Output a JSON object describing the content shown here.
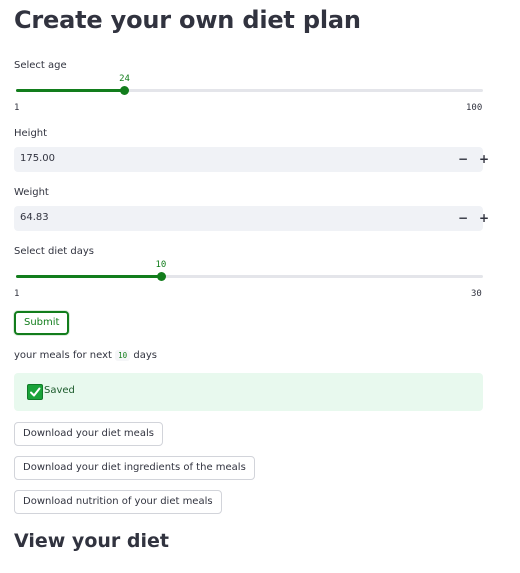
{
  "page": {
    "title": "Create your own diet plan",
    "section_heading": "View your diet"
  },
  "age_slider": {
    "label": "Select age",
    "value": 24,
    "min": 1,
    "max": 100,
    "min_label": "1",
    "max_label": "100",
    "value_label": "24"
  },
  "height_input": {
    "label": "Height",
    "value": "175.00",
    "minus": "−",
    "plus": "+"
  },
  "weight_input": {
    "label": "Weight",
    "value": "64.83",
    "minus": "−",
    "plus": "+"
  },
  "days_slider": {
    "label": "Select diet days",
    "value": 10,
    "min": 1,
    "max": 30,
    "min_label": "1",
    "max_label": "30",
    "value_label": "10"
  },
  "submit_button": {
    "label": "Submit"
  },
  "meals_text": {
    "prefix": "your meals for next",
    "days": "10",
    "suffix": "days"
  },
  "status": {
    "message": "Saved",
    "icon": "check-icon",
    "color": "#1aa33a"
  },
  "downloads": {
    "meals": "Download your diet meals",
    "ingredients": "Download your diet ingredients of the meals",
    "nutrition": "Download nutrition of your diet meals"
  },
  "colors": {
    "accent": "#127d1c",
    "text": "#31333f",
    "input_bg": "#f0f2f6",
    "success_bg": "#e8f9ee"
  }
}
